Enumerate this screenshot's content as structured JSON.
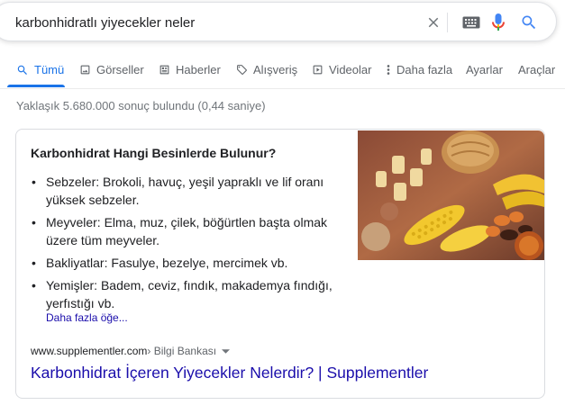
{
  "search": {
    "query": "karbonhidratlı yiyecekler neler"
  },
  "tabs": [
    {
      "label": "Tümü",
      "icon": "search-icon",
      "active": true
    },
    {
      "label": "Görseller",
      "icon": "image-icon"
    },
    {
      "label": "Haberler",
      "icon": "news-icon"
    },
    {
      "label": "Alışveriş",
      "icon": "tag-icon"
    },
    {
      "label": "Videolar",
      "icon": "play-icon"
    },
    {
      "label": "Daha fazla",
      "icon": "more-vert-icon"
    },
    {
      "label": "Ayarlar"
    },
    {
      "label": "Araçlar"
    }
  ],
  "results": {
    "stats": "Yaklaşık 5.680.000 sonuç bulundu (0,44 saniye)"
  },
  "snippet": {
    "title": "Karbonhidrat Hangi Besinlerde Bulunur?",
    "bullets": [
      "Sebzeler: Brokoli, havuç, yeşil yapraklı ve lif oranı yüksek sebzeler.",
      "Meyveler: Elma, muz, çilek, böğürtlen başta olmak üzere tüm meyveler.",
      "Bakliyatlar: Fasulye, bezelye, mercimek vb.",
      "Yemişler: Badem, ceviz, fındık, makademya fındığı, yerfıstığı vb."
    ],
    "more_label": "Daha fazla öğe...",
    "image_icon": "food-photo",
    "cite_domain": "www.supplementler.com",
    "cite_path": " › Bilgi Bankası",
    "result_title": "Karbonhidrat İçeren Yiyecekler Nelerdir? | Supplementler"
  },
  "colors": {
    "link": "#1a0dab",
    "accent": "#1a73e8",
    "muted": "#70757a"
  }
}
